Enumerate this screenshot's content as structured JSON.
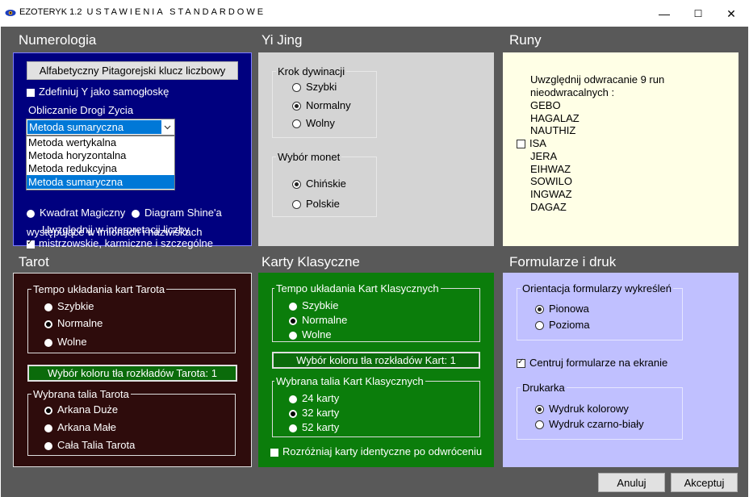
{
  "window": {
    "app_name": "EZOTERYK 1.2",
    "title": "USTAWIENIA STANDARDOWE",
    "minimize": "—",
    "maximize": "☐",
    "close": "✕"
  },
  "numerologia": {
    "title": "Numerologia",
    "key_button": "Alfabetyczny Pitagorejski klucz liczbowy",
    "define_y": "Zdefiniuj Y jako samogłoskę",
    "path_label": "Obliczanie Drogi Zycia",
    "method_selected": "Metoda sumaryczna",
    "method_options": [
      "Metoda wertykalna",
      "Metoda horyzontalna",
      "Metoda redukcyjna",
      "Metoda sumaryczna"
    ],
    "square_partial": "Kwadrat Magiczny",
    "diagram_partial": "Diagram Shine'a",
    "include_line1": "Uwzględnij  w interpretacji liczby",
    "include_line2": "mistrzowskie, karmiczne i szczególne",
    "include_line3": "występujące w imionach i nazwiskach"
  },
  "yijing": {
    "title": "Yi Jing",
    "step_label": "Krok dywinacji",
    "step_options": [
      "Szybki",
      "Normalny",
      "Wolny"
    ],
    "coins_label": "Wybór monet",
    "coin_options": [
      "Chińskie",
      "Polskie"
    ]
  },
  "runy": {
    "title": "Runy",
    "intro1": "Uwzględnij odwracanie 9 run",
    "intro2": "nieodwracalnych :",
    "runes": [
      "GEBO",
      "HAGALAZ",
      "NAUTHIZ",
      "ISA",
      "JERA",
      "EIHWAZ",
      "SOWILO",
      "INGWAZ",
      "DAGAZ"
    ]
  },
  "tarot": {
    "title": "Tarot",
    "tempo_label": "Tempo układania kart Tarota",
    "tempo_options": [
      "Szybkie",
      "Normalne",
      "Wolne"
    ],
    "color_button": "Wybór koloru tła rozkładów Tarota: 1",
    "deck_label": "Wybrana talia Tarota",
    "deck_options": [
      "Arkana Duże",
      "Arkana Małe",
      "Cała Talia Tarota"
    ]
  },
  "karty": {
    "title": "Karty Klasyczne",
    "tempo_label": "Tempo układania Kart Klasycznych",
    "tempo_options": [
      "Szybkie",
      "Normalne",
      "Wolne"
    ],
    "color_button": "Wybór koloru tła rozkładów Kart: 1",
    "deck_label": "Wybrana talia Kart Klasycznych",
    "deck_options": [
      "24 karty",
      "32 karty",
      "52 karty"
    ],
    "distinguish": "Rozróżniaj karty identyczne po odwróceniu"
  },
  "formularze": {
    "title": "Formularze i druk",
    "orient_label": "Orientacja formularzy wykreśleń",
    "orient_options": [
      "Pionowa",
      "Pozioma"
    ],
    "center": "Centruj formularze na ekranie",
    "printer_label": "Drukarka",
    "printer_options": [
      "Wydruk kolorowy",
      "Wydruk czarno-biały"
    ]
  },
  "buttons": {
    "cancel": "Anuluj",
    "accept": "Akceptuj"
  },
  "colors": {
    "numerologia_bg": "#00007f",
    "yijing_bg": "#d4d4d4",
    "runy_bg": "#ffffe6",
    "tarot_bg": "#2e0c0c",
    "karty_bg": "#0b7d0b",
    "formularze_bg": "#c0c0ff"
  }
}
